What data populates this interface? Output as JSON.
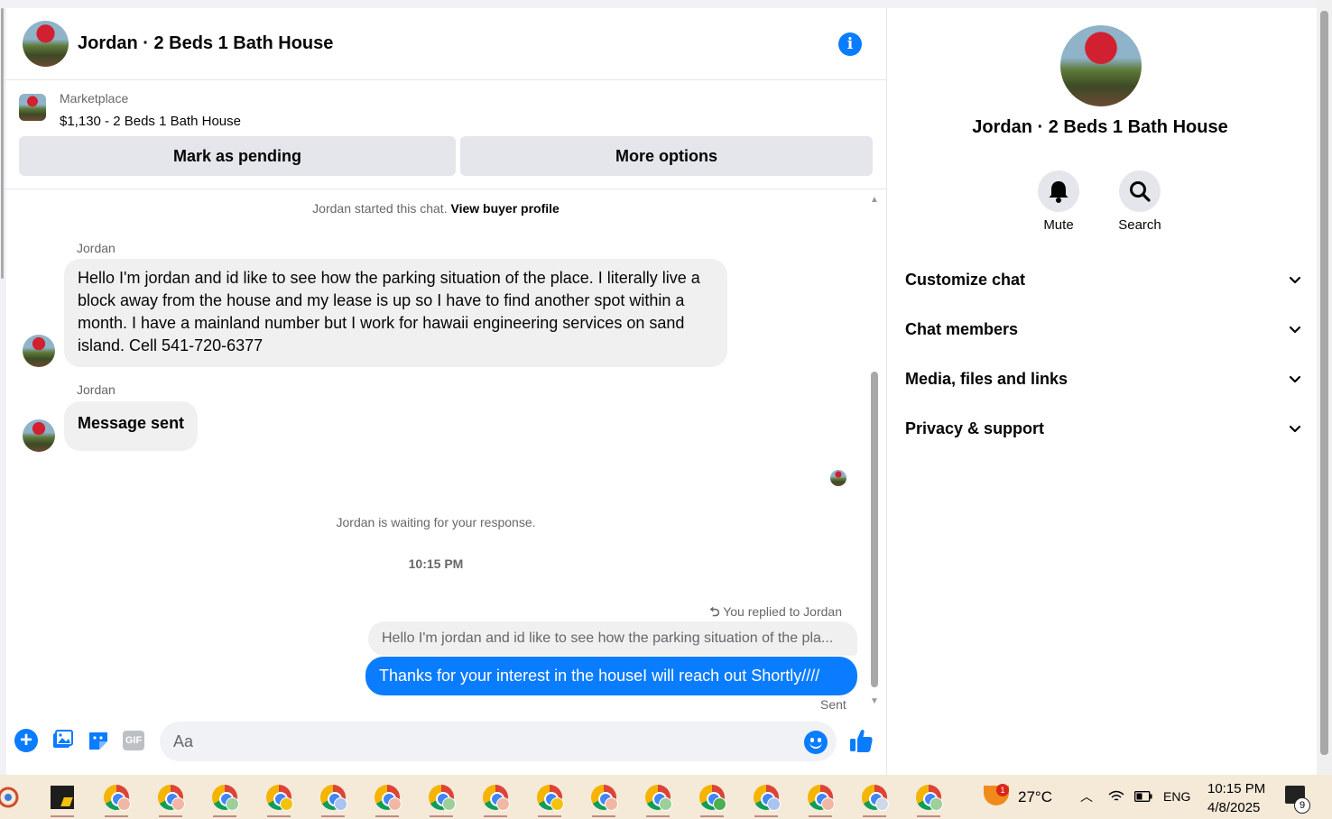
{
  "header": {
    "title": "Jordan · 2 Beds 1 Bath House"
  },
  "marketplace": {
    "label": "Marketplace",
    "listing": "$1,130 - 2 Beds 1 Bath House",
    "pending_button": "Mark as pending",
    "more_button": "More options"
  },
  "messages": {
    "started_prefix": "Jordan started this chat.",
    "view_buyer_profile": "View buyer profile",
    "sender1": "Jordan",
    "message1": "Hello I'm jordan and id like to see how the parking situation of the place. I literally live a block away from the house and my lease is up so I have to find another spot within a month. I have a mainland number but I work for hawaii engineering services on sand island. Cell 541-720-6377",
    "sender2": "Jordan",
    "message2": "Message sent",
    "waiting": "Jordan is waiting for your response.",
    "time": "10:15 PM",
    "replied_to": "You replied to Jordan",
    "quoted": "Hello I'm jordan and id like to see how the parking situation of the pla...",
    "reply": "Thanks for your interest in the houseI will reach out Shortly////",
    "status": "Sent"
  },
  "composer": {
    "placeholder": "Aa",
    "gif_label": "GIF"
  },
  "right_panel": {
    "title": "Jordan · 2 Beds 1 Bath House",
    "mute_label": "Mute",
    "search_label": "Search",
    "sections": [
      "Customize chat",
      "Chat members",
      "Media, files and links",
      "Privacy & support"
    ]
  },
  "taskbar": {
    "temperature": "27°C",
    "language": "ENG",
    "time": "10:15 PM",
    "date": "4/8/2025",
    "notification_count": "9",
    "weather_badge": "1"
  },
  "colors": {
    "accent": "#0a7cff",
    "bubble_in": "#f0f0f0",
    "taskbar": "#f5e9d8"
  }
}
